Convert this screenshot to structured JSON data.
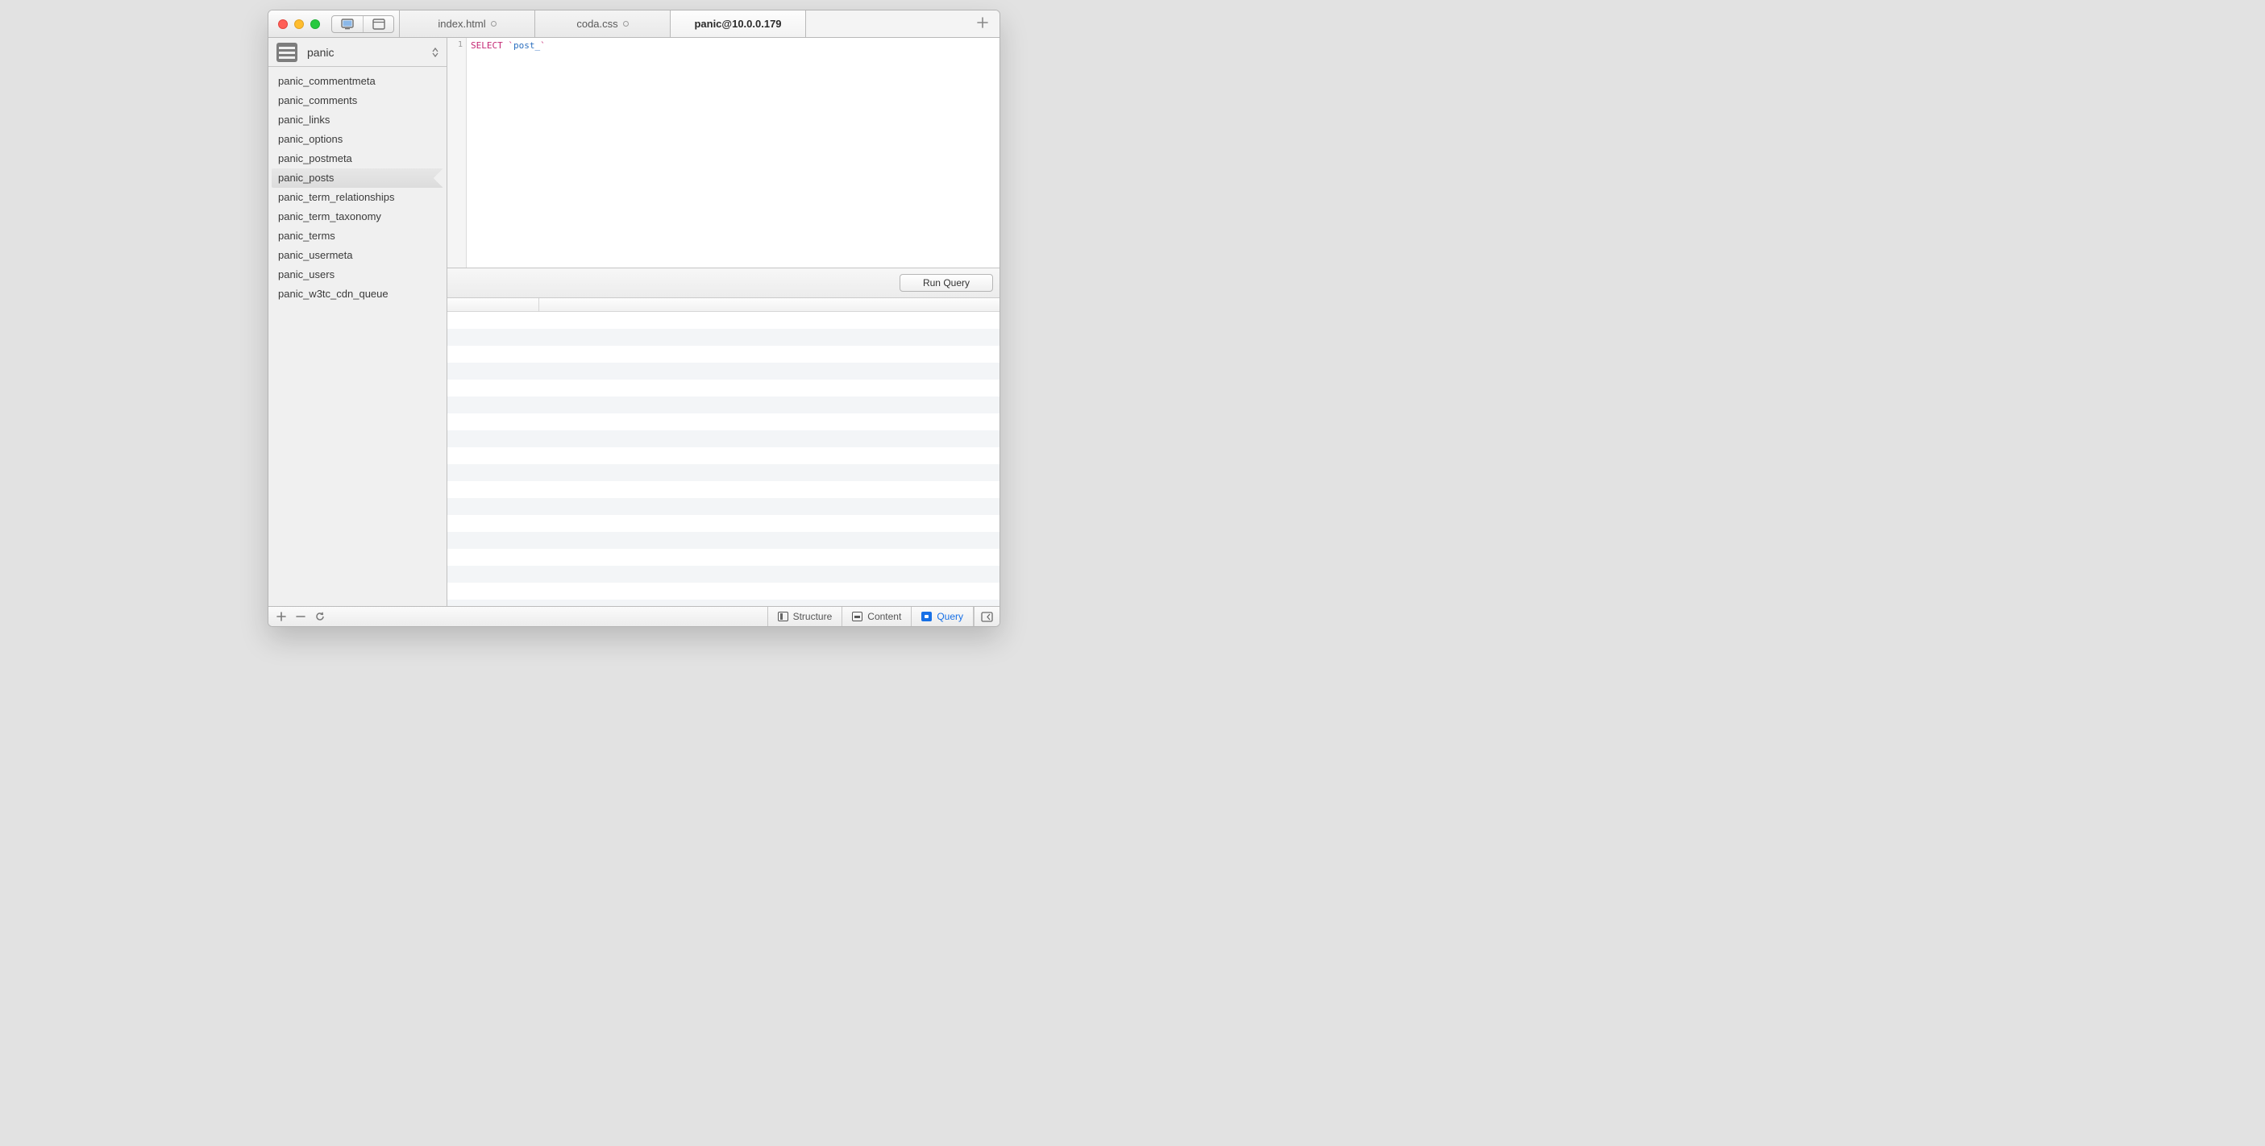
{
  "tabs": [
    {
      "label": "index.html",
      "unsaved": true,
      "active": false
    },
    {
      "label": "coda.css",
      "unsaved": true,
      "active": false
    },
    {
      "label": "panic@10.0.0.179",
      "unsaved": false,
      "active": true
    }
  ],
  "sidebar": {
    "database_name": "panic",
    "tables": [
      "panic_commentmeta",
      "panic_comments",
      "panic_links",
      "panic_options",
      "panic_postmeta",
      "panic_posts",
      "panic_term_relationships",
      "panic_term_taxonomy",
      "panic_terms",
      "panic_usermeta",
      "panic_users",
      "panic_w3tc_cdn_queue"
    ],
    "selected_index": 5
  },
  "editor": {
    "line_number": "1",
    "tokens": {
      "keyword": "SELECT",
      "backtick_open": " `",
      "identifier": "post_",
      "backtick_close": "`"
    }
  },
  "run_button_label": "Run Query",
  "results": {
    "row_count": 18
  },
  "footer": {
    "structure": "Structure",
    "content": "Content",
    "query": "Query"
  }
}
